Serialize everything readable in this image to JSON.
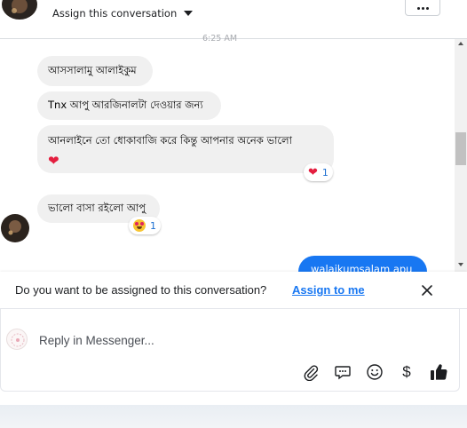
{
  "header": {
    "assign_label": "Assign this conversation"
  },
  "thread": {
    "timestamp": "6:25 AM",
    "messages": [
      {
        "text": "আসসালামু আলাইকুম"
      },
      {
        "text": "Tnx আপু আরজিনালটা দেওয়ার জন্য"
      },
      {
        "text": "আনলাইনে তো ধোকাবাজি করে কিন্তু আপনার অনেক ভালো",
        "emoji": "❤",
        "reaction": {
          "icon": "heart",
          "count": "1"
        }
      },
      {
        "text": "ভালো বাসা রইলো আপু",
        "reaction": {
          "icon": "heart-eyes",
          "count": "1"
        }
      }
    ],
    "outgoing": {
      "text": "walaikumsalam apu"
    }
  },
  "assign_banner": {
    "question": "Do you want to be assigned to this conversation?",
    "link": "Assign to me"
  },
  "composer": {
    "placeholder": "Reply in Messenger...",
    "tools": [
      "attachment-icon",
      "saved-replies-icon",
      "emoji-icon",
      "dollar-icon",
      "thumbs-up-icon"
    ],
    "dollar_glyph": "$"
  },
  "colors": {
    "accent": "#1877f2",
    "incoming_bubble": "#f0f0f0",
    "heart": "#e41e3f"
  }
}
